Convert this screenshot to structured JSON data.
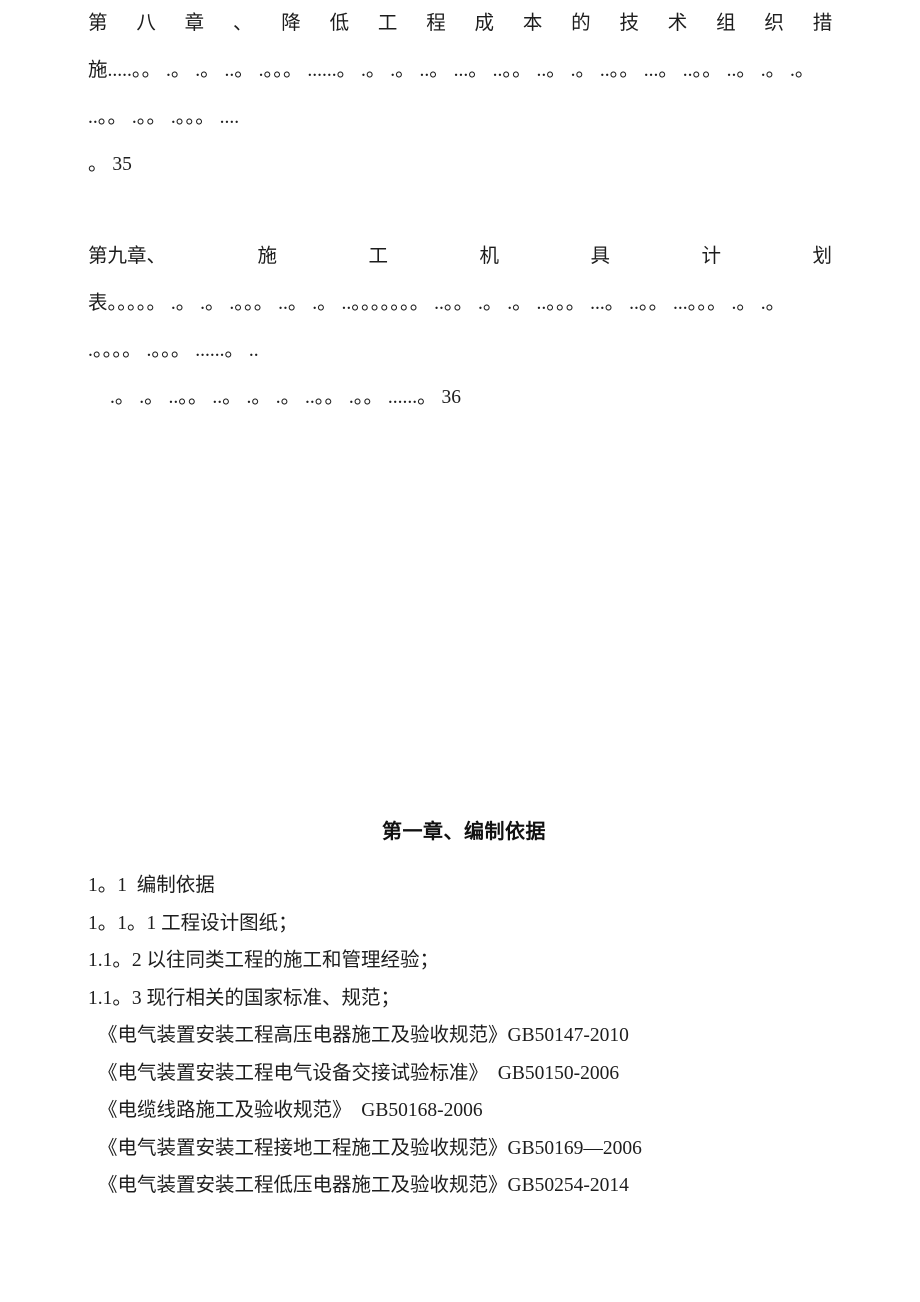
{
  "document": {
    "page_background": "#ffffff",
    "text_color": "#1d1d1d"
  },
  "toc": {
    "entries": [
      {
        "id": "chapter-8",
        "title_line": "第 八 章 、 降 低 工 程 成 本 的 技 术 组 织 措",
        "title_chars": [
          "第",
          "八",
          "章",
          "、",
          "降",
          "低",
          "工",
          "程",
          "成",
          "本",
          "的",
          "技",
          "术",
          "组",
          "织",
          "措"
        ],
        "leader_line": "施.....。。 .。 .。 ..。 .。。。 ......。 .。 .。 ..。 ...。 ..。。 ..。 .。 ..。。 ...。 ..。。 ..。 .。 .。 ..。。 .。。 .。。。 ....",
        "tail_line": "。 35",
        "page_number": "35"
      },
      {
        "id": "chapter-9",
        "title_line": "第九章、 施 工 机 具 计 划",
        "title_prefix": "第九章、",
        "title_chars": [
          "施",
          "工",
          "机",
          "具",
          "计",
          "划"
        ],
        "leader_line": "表。。。。。 .。 .。 .。。。 ..。 .。 ..。。。。。。。 ..。。 .。 .。 ..。。。 ...。 ..。。 ...。。。 .。 .。 .。。。。 .。。。 ......。 ..",
        "tail_line": ".。 .。 ..。。 ..。 .。 .。 ..。。 .。。 ......。 36",
        "page_number": "36"
      }
    ]
  },
  "chapter": {
    "heading": "第一章、编制依据",
    "items": [
      {
        "id": "1-1",
        "text": "1。1  编制依据"
      },
      {
        "id": "1-1-1",
        "text": "1。1。1 工程设计图纸；"
      },
      {
        "id": "1-1-2",
        "text": "1.1。2 以往同类工程的施工和管理经验；"
      },
      {
        "id": "1-1-3",
        "text": "1.1。3 现行相关的国家标准、规范；"
      }
    ],
    "standards": [
      {
        "id": "gb50147",
        "text": "《电气装置安装工程高压电器施工及验收规范》GB50147-2010",
        "code": "GB50147-2010"
      },
      {
        "id": "gb50150",
        "text": "《电气装置安装工程电气设备交接试验标准》  GB50150-2006",
        "code": "GB50150-2006"
      },
      {
        "id": "gb50168",
        "text": "《电缆线路施工及验收规范》  GB50168-2006",
        "code": "GB50168-2006"
      },
      {
        "id": "gb50169",
        "text": "《电气装置安装工程接地工程施工及验收规范》GB50169—2006",
        "code": "GB50169—2006"
      },
      {
        "id": "gb50254",
        "text": "《电气装置安装工程低压电器施工及验收规范》GB50254-2014",
        "code": "GB50254-2014"
      }
    ]
  }
}
